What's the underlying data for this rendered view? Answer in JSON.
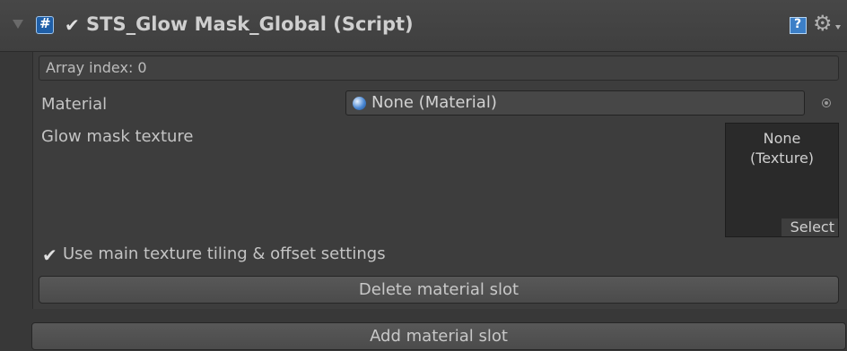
{
  "component": {
    "title": "STS_Glow Mask_Global (Script)",
    "enabled": true
  },
  "element": {
    "array_index_text": "Array index: 0",
    "material_label": "Material",
    "material_value": "None (Material)",
    "glow_mask_label": "Glow mask texture",
    "texture_value": "None\n(Texture)",
    "texture_select_label": "Select",
    "tiling_label": "Use main texture tiling & offset settings",
    "tiling_checked": true,
    "delete_button_label": "Delete material slot"
  },
  "add_button_label": "Add material slot",
  "icons": {
    "foldout": "foldout-arrow-icon",
    "script": "script-icon",
    "help": "help-icon",
    "settings": "gear-icon",
    "material": "material-sphere-icon",
    "object_picker": "object-picker-icon",
    "checkbox": "check-icon"
  },
  "colors": {
    "background": "#383838",
    "header": "#444444",
    "script_icon": "#1f5fa8",
    "help_icon": "#3c7fc7"
  }
}
